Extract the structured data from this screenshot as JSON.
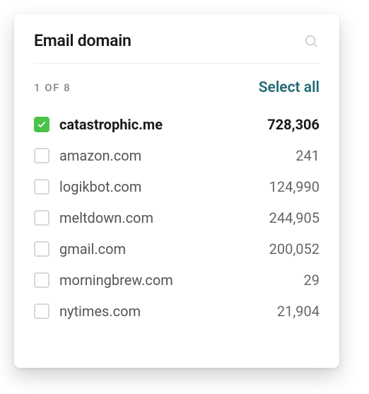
{
  "panel": {
    "title": "Email domain",
    "search_icon": "search-icon",
    "count_label": "1 OF 8",
    "select_all_label": "Select all",
    "accent_color": "#1f6b73",
    "checked_color": "#4ac24a"
  },
  "items": [
    {
      "domain": "catastrophic.me",
      "count": "728,306",
      "checked": true
    },
    {
      "domain": "amazon.com",
      "count": "241",
      "checked": false
    },
    {
      "domain": "logikbot.com",
      "count": "124,990",
      "checked": false
    },
    {
      "domain": "meltdown.com",
      "count": "244,905",
      "checked": false
    },
    {
      "domain": "gmail.com",
      "count": "200,052",
      "checked": false
    },
    {
      "domain": "morningbrew.com",
      "count": "29",
      "checked": false
    },
    {
      "domain": "nytimes.com",
      "count": "21,904",
      "checked": false
    }
  ]
}
